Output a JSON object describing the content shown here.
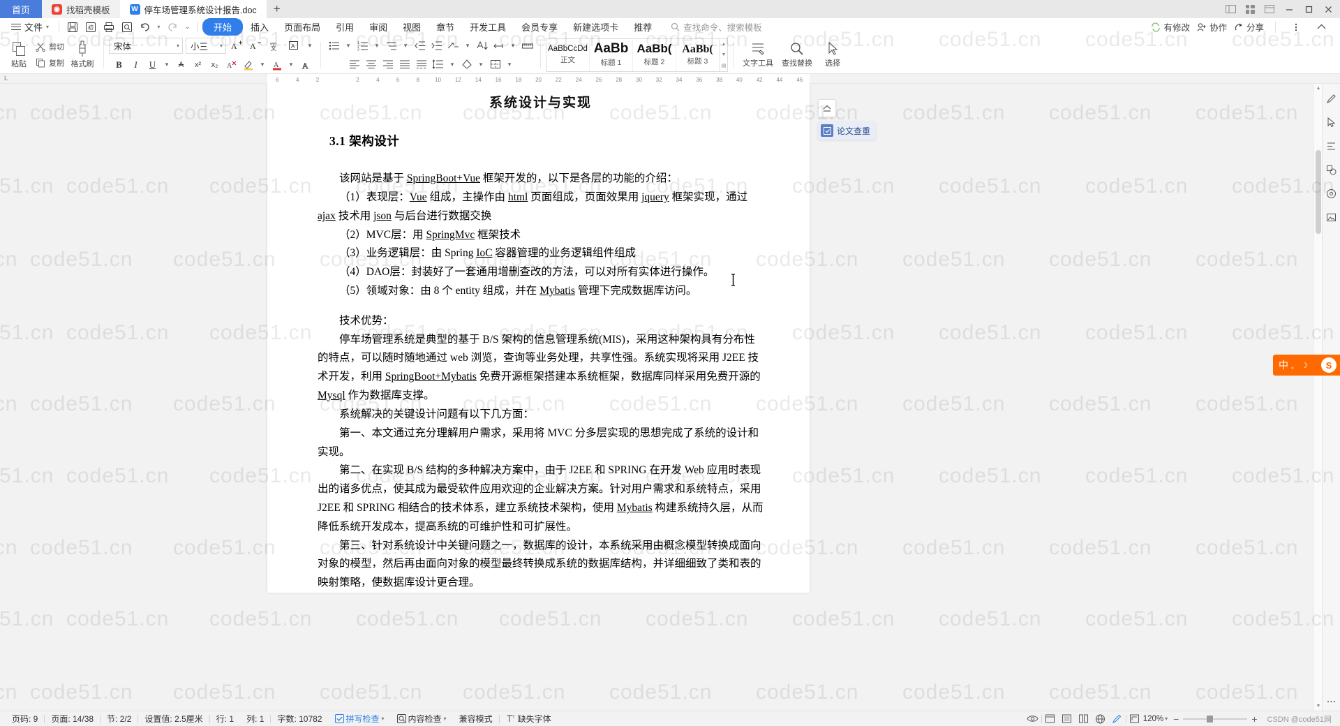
{
  "window": {
    "tabs": [
      {
        "label": "首页",
        "type": "home"
      },
      {
        "label": "找稻壳模板",
        "type": "inactive",
        "icon": "docer-icon",
        "icon_color": "#e8443a",
        "icon_glyph": "◉"
      },
      {
        "label": "停车场管理系统设计报告.doc",
        "type": "active",
        "icon": "wps-writer-icon",
        "icon_color": "#2f7eea",
        "icon_glyph": "W"
      }
    ],
    "new_tab_label": "+",
    "controls": {
      "grid_view": "窗格视图",
      "layout": "布局",
      "minimize": "—",
      "maximize": "▢",
      "close": "✕"
    }
  },
  "menubar": {
    "file_label": "文件",
    "quick_access": [
      "save-icon",
      "save-as-icon",
      "print-icon",
      "print-preview-icon",
      "undo-icon",
      "redo-icon",
      "customize-icon"
    ],
    "items": [
      {
        "label": "开始",
        "active": true
      },
      {
        "label": "插入",
        "active": false
      },
      {
        "label": "页面布局",
        "active": false
      },
      {
        "label": "引用",
        "active": false
      },
      {
        "label": "审阅",
        "active": false
      },
      {
        "label": "视图",
        "active": false
      },
      {
        "label": "章节",
        "active": false
      },
      {
        "label": "开发工具",
        "active": false
      },
      {
        "label": "会员专享",
        "active": false
      },
      {
        "label": "新建选项卡",
        "active": false
      },
      {
        "label": "推荐",
        "active": false
      }
    ],
    "search_placeholder": "查找命令、搜索模板",
    "right_items": [
      {
        "label": "有修改",
        "icon": "sync-icon"
      },
      {
        "label": "协作",
        "icon": "collaborate-icon"
      },
      {
        "label": "分享",
        "icon": "share-icon"
      }
    ],
    "more_icon": "more-vertical-icon",
    "collapse_icon": "chevron-up-icon"
  },
  "ribbon": {
    "clipboard": {
      "paste_label": "粘贴",
      "cut_label": "剪切",
      "copy_label": "复制",
      "format_painter_label": "格式刷"
    },
    "font": {
      "family": "宋体",
      "size": "小三",
      "grow_label": "A⁺",
      "shrink_label": "A⁻",
      "bold": "B",
      "italic": "I",
      "underline": "U",
      "strikethrough": "abc",
      "superscript": "x²",
      "subscript": "x₂",
      "text_effect": "A",
      "highlight": "A",
      "font_color": "A",
      "clear_format": "clear-format-icon",
      "pinyin": "拼音指南",
      "char_border": "字符边框"
    },
    "paragraph": {
      "bullets": "项目符号",
      "numbering": "编号",
      "multilevel": "多级列表",
      "decrease_indent": "减少缩进",
      "increase_indent": "增加缩进",
      "sort": "排序",
      "show_marks": "显示段落标记",
      "align_left": "左对齐",
      "align_center": "居中",
      "align_right": "右对齐",
      "justify": "两端对齐",
      "distribute": "分散对齐",
      "line_spacing": "行距",
      "shading": "底纹",
      "borders": "边框"
    },
    "styles": [
      {
        "sample": "AaBbCcDd",
        "name": "正文"
      },
      {
        "sample": "AaBb",
        "name": "标题 1"
      },
      {
        "sample": "AaBb(",
        "name": "标题 2"
      },
      {
        "sample": "AaBb(",
        "name": "标题 3"
      }
    ],
    "tools": [
      {
        "label": "文字工具",
        "icon": "text-tools-icon"
      },
      {
        "label": "查找替换",
        "icon": "search-replace-icon"
      },
      {
        "label": "选择",
        "icon": "select-icon"
      }
    ]
  },
  "ruler": {
    "corner_label": "L",
    "ticks": [
      "6",
      "4",
      "2",
      "",
      "2",
      "4",
      "6",
      "8",
      "10",
      "12",
      "14",
      "16",
      "18",
      "20",
      "22",
      "24",
      "26",
      "28",
      "30",
      "32",
      "34",
      "36",
      "38",
      "40",
      "42",
      "44",
      "46"
    ]
  },
  "document": {
    "chapter_title": "系统设计与实现",
    "section_title": "3.1 架构设计",
    "paragraphs": [
      {
        "text": "该网站是基于 SpringBoot+Vue 框架开发的，以下是各层的功能的介绍：",
        "indent": true
      },
      {
        "text": "（1）表现层：Vue 组成，主操作由 html 页面组成，页面效果用 jquery 框架实现，通过 ajax 技术用 json 与后台进行数据交换",
        "indent": true
      },
      {
        "text": "（2）MVC层：用 SpringMvc 框架技术",
        "indent": true
      },
      {
        "text": "（3）业务逻辑层：由 Spring IoC 容器管理的业务逻辑组件组成",
        "indent": true
      },
      {
        "text": "（4）DAO层：封装好了一套通用增删查改的方法，可以对所有实体进行操作。",
        "indent": true
      },
      {
        "text": "（5）领域对象：由 8 个 entity 组成，并在 Mybatis 管理下完成数据库访问。",
        "indent": true
      },
      {
        "text": "技术优势：",
        "indent": true
      },
      {
        "text": "停车场管理系统是典型的基于 B/S 架构的信息管理系统(MIS)，采用这种架构具有分布性的特点，可以随时随地通过 web 浏览，查询等业务处理，共享性强。系统实现将采用 J2EE 技术开发，利用 SpringBoot+Mybatis 免费开源框架搭建本系统框架，数据库同样采用免费开源的 Mysql 作为数据库支撑。",
        "indent": true
      },
      {
        "text": "系统解决的关键设计问题有以下几方面：",
        "indent": true
      },
      {
        "text": "第一、本文通过充分理解用户需求，采用将 MVC 分多层实现的思想完成了系统的设计和实现。",
        "indent": true
      },
      {
        "text": "第二、在实现 B/S 结构的多种解决方案中，由于 J2EE 和 SPRING 在开发 Web 应用时表现出的诸多优点，使其成为最受软件应用欢迎的企业解决方案。针对用户需求和系统特点，采用 J2EE 和 SPRING 相结合的技术体系，建立系统技术架构，使用 Mybatis 构建系统持久层，从而降低系统开发成本，提高系统的可维护性和可扩展性。",
        "indent": true
      },
      {
        "text": "第三、针对系统设计中关键问题之一，数据库的设计，本系统采用由概念模型转换成面向对象的模型，然后再由面向对象的模型最终转换成系统的数据库结构，并详细细致了类和表的映射策略，使数据库设计更合理。",
        "indent": true
      }
    ]
  },
  "floating": {
    "collapse_icon": "collapse-ribbon-icon",
    "check_label": "论文查重",
    "check_icon": "paper-check-icon"
  },
  "rightbar": {
    "icons": [
      "pen-icon",
      "cursor-icon",
      "align-icon",
      "shapes-icon",
      "target-icon",
      "picture-icon",
      "more-dots-icon"
    ]
  },
  "ime": {
    "lang_label": "中",
    "mode_label": "。",
    "logo": "S",
    "accent_color": "#ff6a00"
  },
  "statusbar": {
    "left": [
      {
        "label": "页码: 9",
        "name": "page-number"
      },
      {
        "label": "页面: 14/38",
        "name": "page-count"
      },
      {
        "label": "节: 2/2",
        "name": "section"
      },
      {
        "label": "设置值: 2.5厘米",
        "name": "setting-value"
      },
      {
        "label": "行: 1",
        "name": "line"
      },
      {
        "label": "列: 1",
        "name": "column"
      },
      {
        "label": "字数: 10782",
        "name": "word-count"
      },
      {
        "label": "拼写检查",
        "name": "spell-check",
        "icon": "check-box-icon",
        "caret": true
      },
      {
        "label": "内容检查",
        "name": "content-check",
        "icon": "content-check-icon",
        "caret": true
      },
      {
        "label": "兼容模式",
        "name": "compat-mode"
      },
      {
        "label": "缺失字体",
        "name": "missing-font",
        "icon": "font-missing-icon"
      }
    ],
    "zoom": "120%",
    "zoom_minus": "−",
    "zoom_plus": "+",
    "view_icons": [
      "eye-icon",
      "web-layout-icon",
      "print-layout-icon",
      "reading-layout-icon",
      "outline-icon",
      "web-icon",
      "edit-icon",
      "fullscreen-icon"
    ],
    "credit": "CSDN @code51网"
  },
  "watermark": {
    "text": "code51.cn",
    "color": "rgba(0,0,0,0.085)"
  }
}
